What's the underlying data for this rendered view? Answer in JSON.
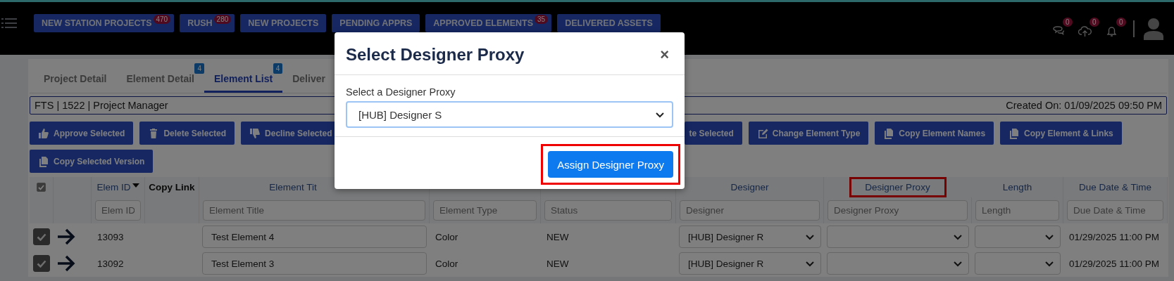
{
  "header": {
    "nav": [
      {
        "label": "NEW STATION PROJECTS",
        "count": "470"
      },
      {
        "label": "RUSH",
        "count": "280"
      },
      {
        "label": "NEW PROJECTS"
      },
      {
        "label": "PENDING APPRS"
      },
      {
        "label": "APPROVED ELEMENTS",
        "count": "35"
      },
      {
        "label": "DELIVERED ASSETS"
      }
    ],
    "notifications": [
      {
        "kind": "chat",
        "count": "0"
      },
      {
        "kind": "upload",
        "count": "0"
      },
      {
        "kind": "bell",
        "count": "0"
      }
    ]
  },
  "tabs": [
    {
      "label": "Project Detail",
      "selected": false
    },
    {
      "label": "Element Detail",
      "badge": "4",
      "selected": false
    },
    {
      "label": "Element List",
      "badge": "4",
      "selected": true
    },
    {
      "label": "Deliver",
      "selected": false
    }
  ],
  "info_bar": {
    "left": "FTS | 1522 | Project Manager",
    "right": "Created On: 01/09/2025 09:50 PM"
  },
  "actions": [
    {
      "label": "Approve Selected",
      "kind": "like"
    },
    {
      "label": "Delete Selected",
      "kind": "trash"
    },
    {
      "label": "Decline Selected",
      "kind": "dislike"
    },
    {
      "label": "te Selected",
      "kind": "none"
    },
    {
      "label": "Change Element Type",
      "kind": "edit"
    },
    {
      "label": "Copy Element Names",
      "kind": "copy"
    },
    {
      "label": "Copy Element & Links",
      "kind": "copy"
    },
    {
      "label": "Copy Selected Version",
      "kind": "copy"
    }
  ],
  "table": {
    "select_all_checked": true,
    "columns": [
      {
        "kind": "checkbox"
      },
      {
        "kind": "blank"
      },
      {
        "kind": "link",
        "label": "Elem ID",
        "sorted": true,
        "placeholder": "Elem ID",
        "highlighted": false
      },
      {
        "kind": "plain",
        "label": "Copy Link",
        "sorted": false,
        "highlighted": false
      },
      {
        "kind": "link",
        "label": "Element Tit",
        "sorted": false,
        "placeholder": "Element Title",
        "highlighted": false
      },
      {
        "kind": "link",
        "sorted": false,
        "placeholder": "Element Type",
        "highlighted": false
      },
      {
        "kind": "link",
        "sorted": false,
        "placeholder": "Status",
        "highlighted": false
      },
      {
        "kind": "link",
        "label": "Designer",
        "sorted": false,
        "placeholder": "Designer",
        "highlighted": false
      },
      {
        "kind": "link",
        "label": "Designer Proxy",
        "sorted": false,
        "placeholder": "Designer Proxy",
        "highlighted": true
      },
      {
        "kind": "link",
        "label": "Length",
        "sorted": false,
        "placeholder": "Length",
        "highlighted": false
      },
      {
        "kind": "link",
        "label": "Due Date & Time",
        "sorted": false,
        "placeholder": "Due Date & Time",
        "highlighted": false
      }
    ],
    "rows": [
      {
        "checked": true,
        "elem_id": "13093",
        "title": "Test Element 4",
        "type": "Color",
        "status": "NEW",
        "designer": "[HUB] Designer R",
        "due": "01/29/2025 11:00 PM"
      },
      {
        "checked": true,
        "elem_id": "13092",
        "title": "Test Element 3",
        "type": "Color",
        "status": "NEW",
        "designer": "[HUB] Designer R",
        "due": "01/29/2025 11:00 PM"
      }
    ]
  },
  "modal": {
    "title": "Select Designer Proxy",
    "close": "×",
    "field_label": "Select a Designer Proxy",
    "value": "[HUB] Designer S",
    "button": "Assign Designer Proxy",
    "button_highlighted": true
  }
}
